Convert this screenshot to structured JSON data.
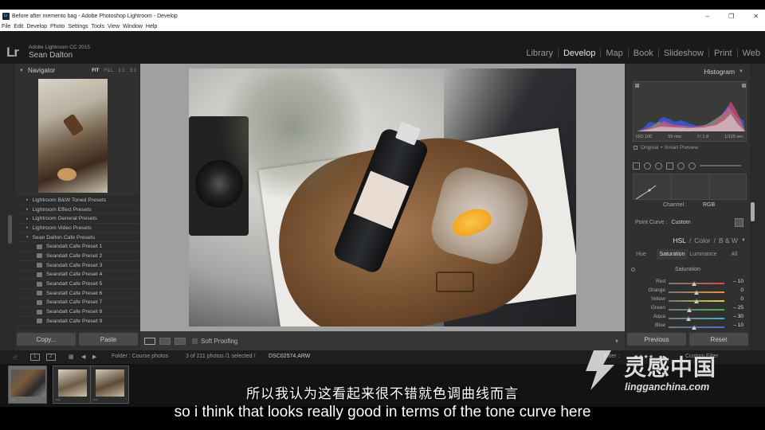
{
  "window": {
    "title": "Before after memento bag - Adobe Photoshop Lightroom - Develop",
    "app_icon": "Lr",
    "controls": [
      "–",
      "❐",
      "✕"
    ]
  },
  "menu": [
    "File",
    "Edit",
    "Develop",
    "Photo",
    "Settings",
    "Tools",
    "View",
    "Window",
    "Help"
  ],
  "identity": {
    "logo": "Lr",
    "app_version": "Adobe Lightroom CC 2015",
    "user": "Sean Dalton"
  },
  "modules": [
    "Library",
    "Develop",
    "Map",
    "Book",
    "Slideshow",
    "Print",
    "Web"
  ],
  "active_module": "Develop",
  "navigator": {
    "title": "Navigator",
    "zoom_options": [
      "FIT",
      "FILL",
      "1:1",
      "3:1"
    ],
    "zoom_selected": "FIT"
  },
  "presets": [
    {
      "label": "Lightroom B&W Toned Presets",
      "kind": "folder"
    },
    {
      "label": "Lightroom Effect Presets",
      "kind": "folder"
    },
    {
      "label": "Lightroom General Presets",
      "kind": "folder"
    },
    {
      "label": "Lightroom Video Presets",
      "kind": "folder"
    },
    {
      "label": "Sean Dalton Cafe Presets",
      "kind": "folder-open"
    },
    {
      "label": "Seandalt Cafe Preset 1",
      "kind": "child"
    },
    {
      "label": "Seandalt Cafe Preset 2",
      "kind": "child"
    },
    {
      "label": "Seandalt Cafe Preset 3",
      "kind": "child"
    },
    {
      "label": "Seandalt Cafe Preset 4",
      "kind": "child"
    },
    {
      "label": "Seandalt Cafe Preset 5",
      "kind": "child"
    },
    {
      "label": "Seandalt Cafe Preset 6",
      "kind": "child"
    },
    {
      "label": "Seandalt Cafe Preset 7",
      "kind": "child"
    },
    {
      "label": "Seandalt Cafe Preset 8",
      "kind": "child"
    },
    {
      "label": "Seandalt Cafe Preset 9",
      "kind": "child"
    }
  ],
  "left_buttons": {
    "copy": "Copy...",
    "paste": "Paste"
  },
  "toolbar": {
    "soft_proofing": "Soft Proofing",
    "collapse_arrow": "▾"
  },
  "histogram": {
    "title": "Histogram",
    "iso": "ISO 100",
    "focal": "55 mm",
    "aperture": "f / 1.8",
    "shutter": "1/125 sec",
    "preview": "Original + Smart Preview"
  },
  "tone_curve": {
    "channel_label": "Channel :",
    "channel_value": "RGB",
    "point_curve_label": "Point Curve :",
    "point_curve_value": "Custom"
  },
  "hsl": {
    "header": [
      "HSL",
      "Color",
      "B & W"
    ],
    "header_active": "HSL",
    "tabs": [
      "Hue",
      "Saturation",
      "Luminance",
      "All"
    ],
    "tab_active": "Saturation",
    "section": "Saturation",
    "rows": [
      {
        "label": "Red",
        "value": "– 10",
        "level": -10,
        "color": "#e04848"
      },
      {
        "label": "Orange",
        "value": "0",
        "level": 0,
        "color": "#e8933a"
      },
      {
        "label": "Yellow",
        "value": "0",
        "level": 0,
        "color": "#e2d33c"
      },
      {
        "label": "Green",
        "value": "– 25",
        "level": -25,
        "color": "#4bb04b"
      },
      {
        "label": "Aqua",
        "value": "– 30",
        "level": -30,
        "color": "#3fb5b5"
      },
      {
        "label": "Blue",
        "value": "– 10",
        "level": -10,
        "color": "#4a6fd8"
      }
    ]
  },
  "right_buttons": {
    "previous": "Previous",
    "reset": "Reset"
  },
  "filmstrip": {
    "screen_1": "1",
    "screen_2": "2",
    "folder": "Folder : Course photos",
    "count": "3 of 211 photos /1 selected /",
    "filename": "DSC02574.ARW",
    "filter_label": "Filter :",
    "filter_value": "Custom Filter",
    "stars": "★★★★"
  },
  "thumbnails": [
    "photo-1",
    "photo-2",
    "photo-3"
  ],
  "subtitles": {
    "chinese": "所以我认为这看起来很不错就色调曲线而言",
    "english": "so i think that looks really good in terms of the tone curve here"
  },
  "watermark": {
    "brand": "灵感中国",
    "url": "lingganchina.com"
  }
}
